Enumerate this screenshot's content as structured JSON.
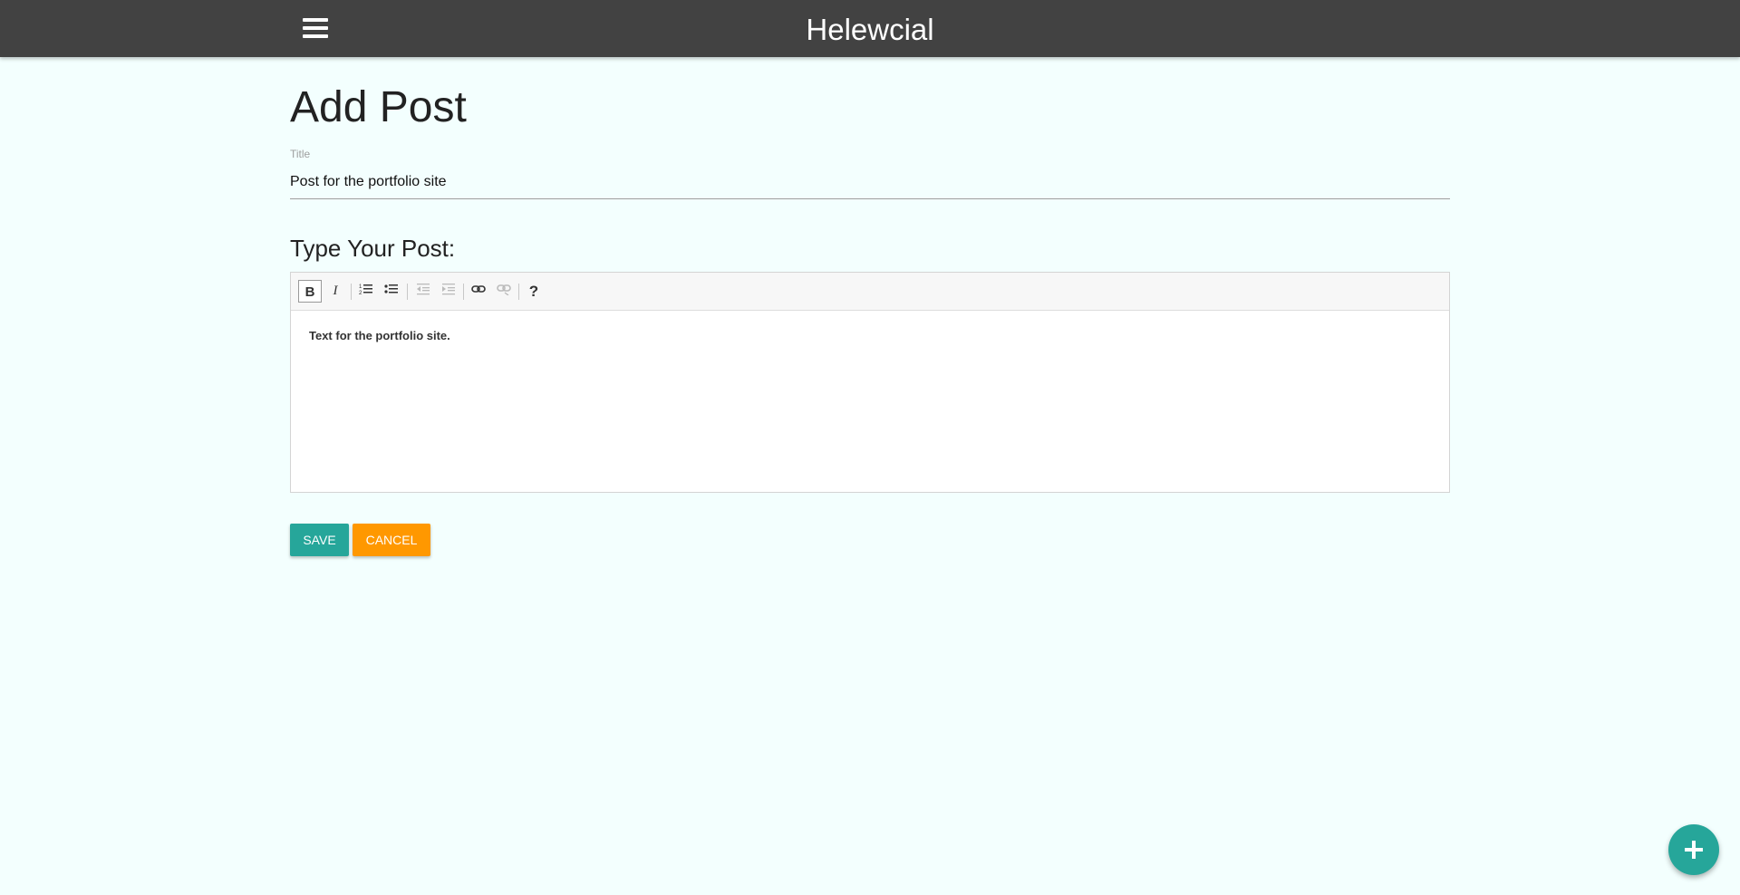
{
  "navbar": {
    "brand": "Helewcial",
    "menu_icon": "hamburger-menu-icon"
  },
  "page": {
    "title": "Add Post"
  },
  "form": {
    "title_label": "Title",
    "title_value": "Post for the portfolio site",
    "post_label": "Type Your Post:",
    "editor_content": "Text for the portfolio site."
  },
  "toolbar": {
    "bold": "B",
    "italic": "I",
    "ordered_list_icon": "ordered-list-icon",
    "unordered_list_icon": "unordered-list-icon",
    "outdent_icon": "outdent-icon",
    "indent_icon": "indent-icon",
    "link_icon": "link-icon",
    "unlink_icon": "unlink-icon",
    "help": "?"
  },
  "buttons": {
    "save": "Save",
    "cancel": "Cancel"
  },
  "fab": {
    "icon": "plus-icon"
  },
  "colors": {
    "navbar": "#424242",
    "background": "#f3fffe",
    "primary": "#26a69a",
    "accent": "#ff9800"
  }
}
